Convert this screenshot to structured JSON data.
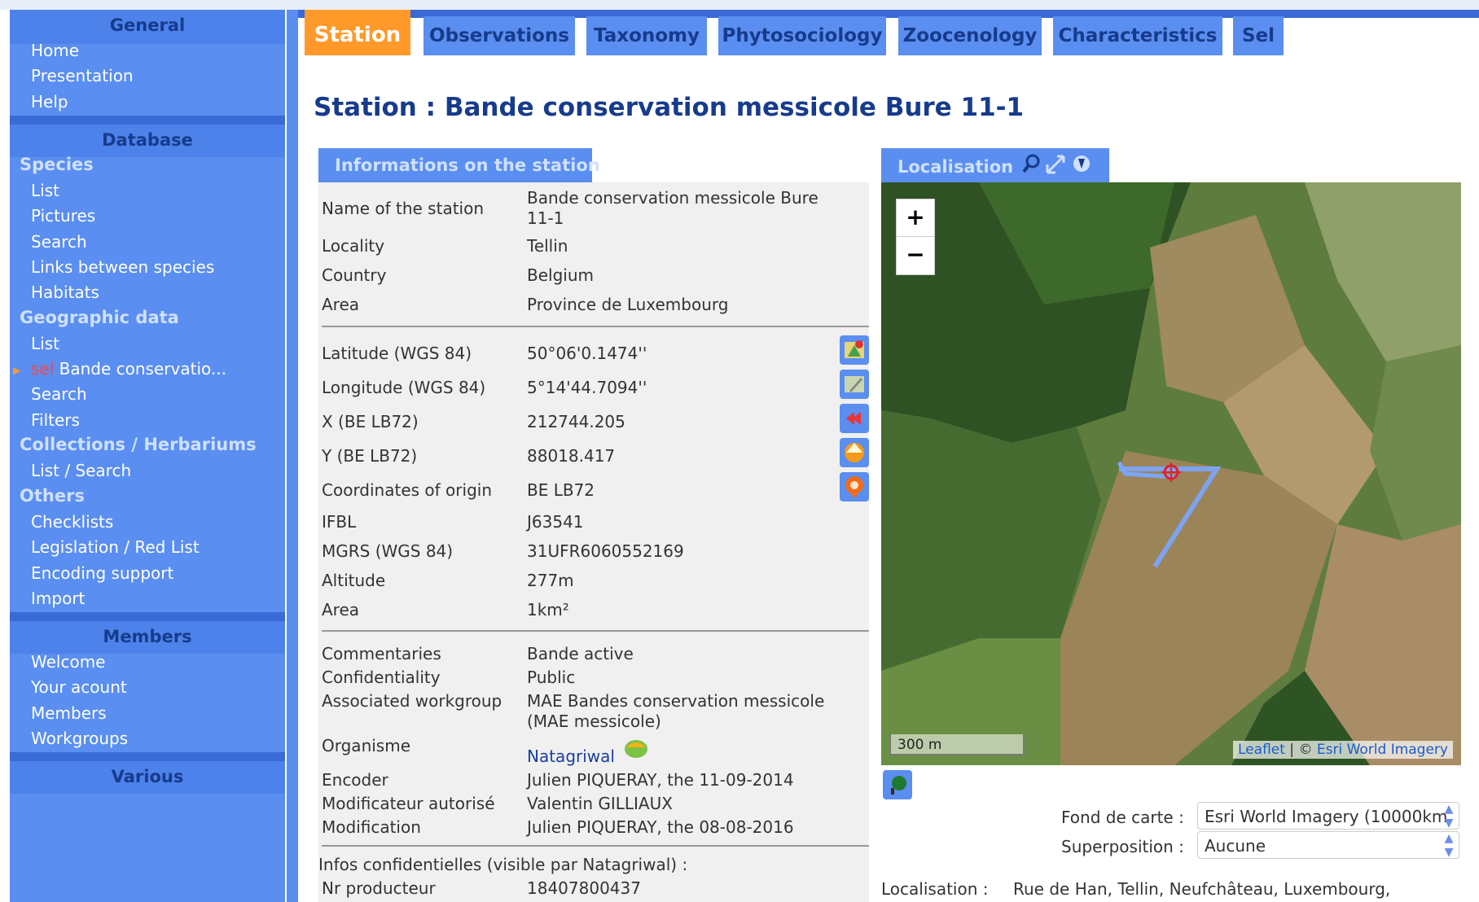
{
  "sidebar": {
    "general": {
      "title": "General",
      "items": [
        "Home",
        "Presentation",
        "Help"
      ]
    },
    "database": {
      "title": "Database",
      "species": {
        "title": "Species",
        "items": [
          "List",
          "Pictures",
          "Search",
          "Links between species",
          "Habitats"
        ]
      },
      "geo": {
        "title": "Geographic data",
        "list": "List",
        "sel_prefix": "sel",
        "sel_label": "Bande conservatio...",
        "search": "Search",
        "filters": "Filters"
      },
      "collections": {
        "title": "Collections / Herbariums",
        "items": [
          "List / Search"
        ]
      },
      "others": {
        "title": "Others",
        "items": [
          "Checklists",
          "Legislation / Red List",
          "Encoding support",
          "Import"
        ]
      }
    },
    "members": {
      "title": "Members",
      "items": [
        "Welcome",
        "Your acount",
        "Members",
        "Workgroups"
      ]
    },
    "various": {
      "title": "Various"
    }
  },
  "tabs": [
    "Station",
    "Observations",
    "Taxonomy",
    "Phytosociology",
    "Zoocenology",
    "Characteristics",
    "Sel"
  ],
  "active_tab": "Station",
  "page_title": "Station : Bande conservation messicole Bure 11-1",
  "info_panel": {
    "title": "Informations on the station",
    "name_label": "Name of the station",
    "name_value": "Bande conservation messicole Bure 11-1",
    "locality_label": "Locality",
    "locality_value": "Tellin",
    "country_label": "Country",
    "country_value": "Belgium",
    "area_label": "Area",
    "area_value": "Province de Luxembourg",
    "lat_label": "Latitude (WGS 84)",
    "lat_value": "50°06'0.1474''",
    "lon_label": "Longitude (WGS 84)",
    "lon_value": "5°14'44.7094''",
    "x_label": "X (BE LB72)",
    "x_value": "212744.205",
    "y_label": "Y (BE LB72)",
    "y_value": "88018.417",
    "origin_label": "Coordinates of origin",
    "origin_value": "BE LB72",
    "ifbl_label": "IFBL",
    "ifbl_value": "J63541",
    "mgrs_label": "MGRS (WGS 84)",
    "mgrs_value": "31UFR6060552169",
    "alt_label": "Altitude",
    "alt_value": "277m",
    "area2_label": "Area",
    "area2_value": "1km²",
    "comment_label": "Commentaries",
    "comment_value": "Bande active",
    "conf_label": "Confidentiality",
    "conf_value": "Public",
    "wg_label": "Associated workgroup",
    "wg_value": "MAE Bandes conservation messicole (MAE messicole)",
    "org_label": "Organisme",
    "org_value": "Natagriwal",
    "encoder_label": "Encoder",
    "encoder_value": "Julien PIQUERAY, the 11-09-2014",
    "modauth_label": "Modificateur autorisé",
    "modauth_value": "Valentin GILLIAUX",
    "mod_label": "Modification",
    "mod_value": "Julien PIQUERAY, the 08-08-2016",
    "conf_info": "Infos confidentielles (visible par Natagriwal) :",
    "producer_label": "Nr producteur",
    "producer_value": "18407800437"
  },
  "map_panel": {
    "title": "Localisation",
    "zoom_in": "+",
    "zoom_out": "−",
    "scale": "300 m",
    "attribution_leaflet": "Leaflet",
    "attribution_sep": " | © ",
    "attribution_esri": "Esri World Imagery",
    "fond_label": "Fond de carte :",
    "fond_value": "Esri World Imagery (10000km",
    "super_label": "Superposition :",
    "super_value": "Aucune",
    "loc_label": "Localisation :",
    "loc_value": "Rue de Han, Tellin, Neufchâteau, Luxembourg,"
  }
}
